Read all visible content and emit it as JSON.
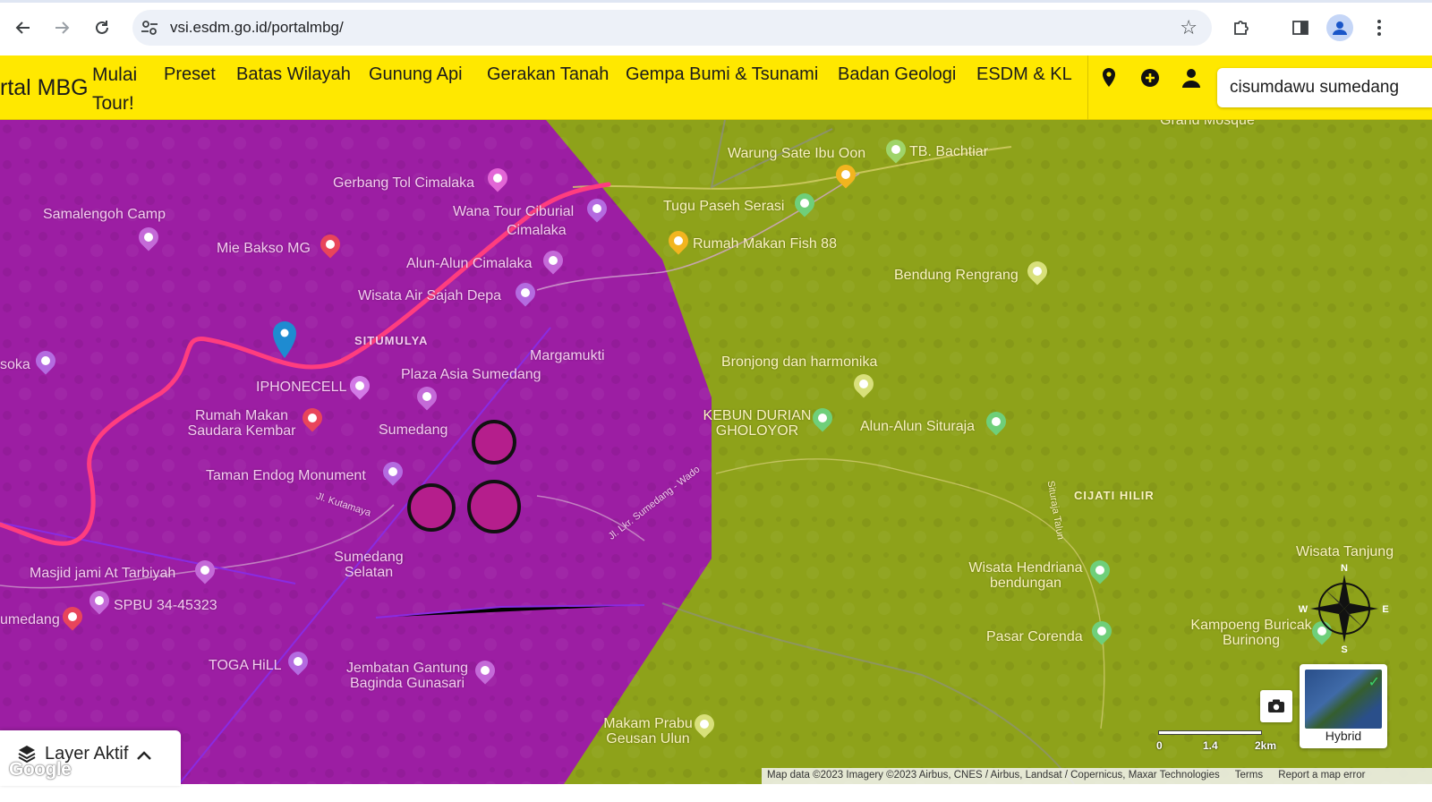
{
  "browser": {
    "url": "vsi.esdm.go.id/portalmbg/"
  },
  "appbar": {
    "brand": "rtal MBG",
    "tour_label": "Mulai Tour!",
    "menu": [
      "Preset",
      "Batas Wilayah",
      "Gunung Api",
      "Gerakan Tanah",
      "Gempa Bumi & Tsunami",
      "Badan Geologi",
      "ESDM & KL"
    ],
    "search_value": "cisumdawu sumedang"
  },
  "map": {
    "colors": {
      "hazard_high": "#9c1ea3",
      "hazard_low": "#8ea21a",
      "toll_road": "#ff3d7f",
      "fault_line": "#8a2be2"
    },
    "places": [
      {
        "name": "Gerbang Tol Cimalaka",
        "zone": "mag"
      },
      {
        "name": "Samalengoh Camp",
        "zone": "mag"
      },
      {
        "name": "Mie Bakso MG",
        "zone": "mag"
      },
      {
        "name": "Wana Tour Ciburial",
        "zone": "mag"
      },
      {
        "name": "Cimalaka",
        "zone": "mag"
      },
      {
        "name": "Alun-Alun Cimalaka",
        "zone": "mag"
      },
      {
        "name": "Wisata Air Sajah Depa",
        "zone": "mag"
      },
      {
        "name": "SITUMULYA",
        "zone": "mag"
      },
      {
        "name": "Margamukti",
        "zone": "mag"
      },
      {
        "name": "soka",
        "zone": "mag"
      },
      {
        "name": "IPHONECELL",
        "zone": "mag"
      },
      {
        "name": "Plaza Asia Sumedang",
        "zone": "mag"
      },
      {
        "name": "Rumah Makan Saudara Kembar",
        "zone": "mag"
      },
      {
        "name": "Sumedang",
        "zone": "mag"
      },
      {
        "name": "Taman Endog Monument",
        "zone": "mag"
      },
      {
        "name": "Jl. Kutamaya",
        "zone": "mag"
      },
      {
        "name": "Jl. Lkr. Sumedang - Wado",
        "zone": "mag"
      },
      {
        "name": "Sumedang Selatan",
        "zone": "mag"
      },
      {
        "name": "Masjid jami At Tarbiyah",
        "zone": "mag"
      },
      {
        "name": "SPBU 34-45323",
        "zone": "mag"
      },
      {
        "name": "umedang",
        "zone": "mag"
      },
      {
        "name": "TOGA HiLL",
        "zone": "mag"
      },
      {
        "name": "Jembatan Gantung Baginda Gunasari",
        "zone": "mag"
      },
      {
        "name": "Warung Sate Ibu Oon",
        "zone": "yel"
      },
      {
        "name": "TB. Bachtiar",
        "zone": "yel"
      },
      {
        "name": "Grand Mosque",
        "zone": "yel"
      },
      {
        "name": "Tugu Paseh Serasi",
        "zone": "yel"
      },
      {
        "name": "Rumah Makan Fish 88",
        "zone": "yel"
      },
      {
        "name": "Bendung Rengrang",
        "zone": "yel"
      },
      {
        "name": "Bronjong dan harmonika",
        "zone": "yel"
      },
      {
        "name": "KEBUN DURIAN GHOLOYOR",
        "zone": "yel"
      },
      {
        "name": "Alun-Alun Situraja",
        "zone": "yel"
      },
      {
        "name": "CIJATI HILIR",
        "zone": "yel"
      },
      {
        "name": "Situraja Talun",
        "zone": "yel"
      },
      {
        "name": "Wisata Hendriana bendungan",
        "zone": "yel"
      },
      {
        "name": "Wisata Tanjung",
        "zone": "yel"
      },
      {
        "name": "Pasar Corenda",
        "zone": "yel"
      },
      {
        "name": "Kampoeng Buricak Burinong",
        "zone": "yel"
      },
      {
        "name": "Makam Prabu Geusan Ulun",
        "zone": "yel"
      }
    ],
    "layer_panel_label": "Layer Aktif",
    "google_logo": "Google",
    "basemap_label": "Hybrid",
    "scale": [
      "0",
      "1.4",
      "2km"
    ],
    "compass": [
      "N",
      "E",
      "S",
      "W"
    ],
    "attribution": [
      "Map data ©2023 Imagery ©2023 Airbus, CNES / Airbus, Landsat / Copernicus, Maxar Technologies",
      "Terms",
      "Report a map error"
    ]
  }
}
